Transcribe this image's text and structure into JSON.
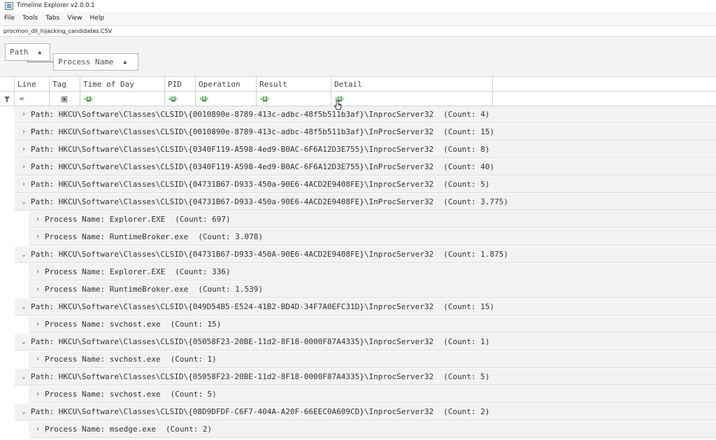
{
  "window": {
    "title": "Timeline Explorer v2.0.0.1"
  },
  "menu": [
    "File",
    "Tools",
    "Tabs",
    "View",
    "Help"
  ],
  "file_tab": "procmon_dll_hijacking_candidates.CSV",
  "group_panel": {
    "chips": [
      {
        "label": "Path",
        "sort": "ascending"
      },
      {
        "label": "Process Name",
        "sort": "ascending"
      }
    ]
  },
  "columns": [
    "Line",
    "Tag",
    "Time of Day",
    "PID",
    "Operation",
    "Result",
    "Detail"
  ],
  "filter_row": {
    "line_filter": "=",
    "text_filter_icon": "abc-filter-icon"
  },
  "rows": [
    {
      "level": 0,
      "expanded": false,
      "label": "Path: HKCU\\Software\\Classes\\CLSID\\{0010890e-8789-413c-adbc-48f5b511b3af}\\InprocServer32",
      "count": "(Count: 4)"
    },
    {
      "level": 0,
      "expanded": false,
      "label": "Path: HKCU\\Software\\Classes\\CLSID\\{0010890e-8789-413c-adbc-48f5b511b3af}\\InProcServer32",
      "count": "(Count: 15)"
    },
    {
      "level": 0,
      "expanded": false,
      "label": "Path: HKCU\\Software\\Classes\\CLSID\\{0340F119-A598-4ed9-B0AC-6F6A12D3E755}\\InprocServer32",
      "count": "(Count: 8)"
    },
    {
      "level": 0,
      "expanded": false,
      "label": "Path: HKCU\\Software\\Classes\\CLSID\\{0340F119-A598-4ed9-B0AC-6F6A12D3E755}\\InProcServer32",
      "count": "(Count: 40)"
    },
    {
      "level": 0,
      "expanded": false,
      "label": "Path: HKCU\\Software\\Classes\\CLSID\\{04731B67-D933-450a-90E6-4ACD2E9408FE}\\InprocServer32",
      "count": "(Count: 5)"
    },
    {
      "level": 0,
      "expanded": true,
      "label": "Path: HKCU\\Software\\Classes\\CLSID\\{04731B67-D933-450a-90E6-4ACD2E9408FE}\\InProcServer32",
      "count": "(Count: 3.775)"
    },
    {
      "level": 1,
      "expanded": false,
      "label": "Process Name: Explorer.EXE",
      "count": "(Count: 697)"
    },
    {
      "level": 1,
      "expanded": false,
      "label": "Process Name: RuntimeBroker.exe",
      "count": "(Count: 3.078)"
    },
    {
      "level": 0,
      "expanded": true,
      "label": "Path: HKCU\\Software\\Classes\\CLSID\\{04731B67-D933-450A-90E6-4ACD2E9408FE}\\InprocServer32",
      "count": "(Count: 1.875)"
    },
    {
      "level": 1,
      "expanded": false,
      "label": "Process Name: Explorer.EXE",
      "count": "(Count: 336)"
    },
    {
      "level": 1,
      "expanded": false,
      "label": "Process Name: RuntimeBroker.exe",
      "count": "(Count: 1.539)"
    },
    {
      "level": 0,
      "expanded": true,
      "label": "Path: HKCU\\Software\\Classes\\CLSID\\{049D54B5-E524-41B2-BD4D-34F7A0EFC31D}\\InprocServer32",
      "count": "(Count: 15)"
    },
    {
      "level": 1,
      "expanded": false,
      "label": "Process Name: svchost.exe",
      "count": "(Count: 15)"
    },
    {
      "level": 0,
      "expanded": true,
      "label": "Path: HKCU\\Software\\Classes\\CLSID\\{05058F23-20BE-11d2-8F18-0000F87A4335}\\InprocServer32",
      "count": "(Count: 1)"
    },
    {
      "level": 1,
      "expanded": false,
      "label": "Process Name: svchost.exe",
      "count": "(Count: 1)"
    },
    {
      "level": 0,
      "expanded": true,
      "label": "Path: HKCU\\Software\\Classes\\CLSID\\{05058F23-20BE-11d2-8F18-0000F87A4335}\\InprocServer32",
      "count": "(Count: 5)"
    },
    {
      "level": 1,
      "expanded": false,
      "label": "Process Name: svchost.exe",
      "count": "(Count: 5)"
    },
    {
      "level": 0,
      "expanded": true,
      "label": "Path: HKCU\\Software\\Classes\\CLSID\\{08D9DFDF-C6F7-404A-A20F-66EEC0A609CD}\\InprocServer32",
      "count": "(Count: 2)"
    },
    {
      "level": 1,
      "expanded": false,
      "label": "Process Name: msedge.exe",
      "count": "(Count: 2)"
    }
  ]
}
